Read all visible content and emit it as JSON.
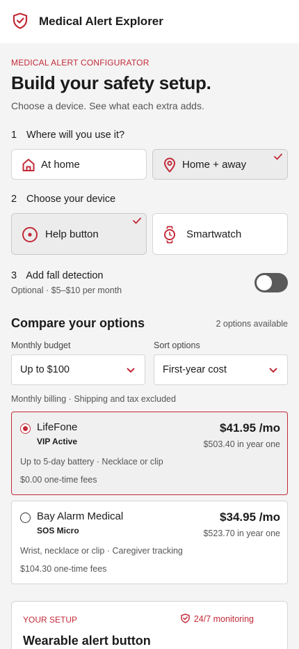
{
  "header": {
    "title": "Medical Alert Explorer",
    "logo_icon": "shield-check-icon"
  },
  "hero": {
    "eyebrow": "MEDICAL ALERT CONFIGURATOR",
    "title": "Build your safety setup.",
    "subtitle": "Choose a device. See what each extra adds."
  },
  "step1": {
    "number": "1",
    "label": "Where will you use it?",
    "options": [
      {
        "label": "At home",
        "icon": "home-icon",
        "selected": false
      },
      {
        "label": "Home + away",
        "icon": "location-pin-icon",
        "selected": true
      }
    ]
  },
  "step2": {
    "number": "2",
    "label": "Choose your device",
    "options": [
      {
        "label": "Help button",
        "icon": "help-button-icon",
        "selected": true
      },
      {
        "label": "Smartwatch",
        "icon": "smartwatch-icon",
        "selected": false
      }
    ]
  },
  "step3": {
    "number": "3",
    "label": "Add fall detection",
    "sub": "Optional · $5–$10 per month",
    "enabled": false
  },
  "compare": {
    "title": "Compare your options",
    "count": "2 options available",
    "budget_label": "Monthly budget",
    "budget_value": "Up to $100",
    "sort_label": "Sort options",
    "sort_value": "First-year cost",
    "billing_note": "Monthly billing · Shipping and tax excluded",
    "plans": [
      {
        "brand": "LifeFone",
        "model": "VIP Active",
        "price": "$41.95 /mo",
        "year_one": "$503.40 in year one",
        "features": "Up to 5-day battery · Necklace or clip",
        "fees": "$0.00 one-time fees",
        "selected": true
      },
      {
        "brand": "Bay Alarm Medical",
        "model": "SOS Micro",
        "price": "$34.95 /mo",
        "year_one": "$523.70 in year one",
        "features": "Wrist, necklace or clip · Caregiver tracking",
        "fees": "$104.30 one-time fees",
        "selected": false
      }
    ]
  },
  "setup": {
    "tag": "YOUR SETUP",
    "monitoring": "24/7 monitoring",
    "title": "Wearable alert button"
  },
  "colors": {
    "accent": "#c22a38",
    "background": "#f4f4f4",
    "card": "#ffffff",
    "selected_card": "#ececec"
  }
}
